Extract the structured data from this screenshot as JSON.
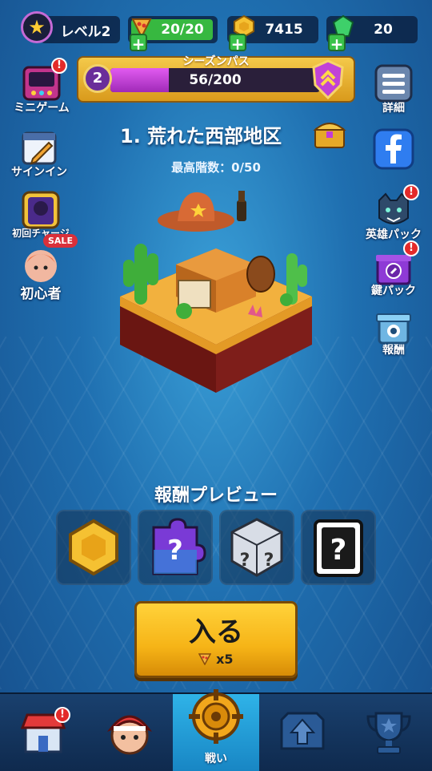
{
  "top_bar": {
    "level_label": "レベル2",
    "energy": "20/20",
    "coins": "7415",
    "gems": "20"
  },
  "season_pass": {
    "title": "シーズンパス",
    "level": "2",
    "progress_text": "56/200",
    "progress_fraction": 0.28
  },
  "left_menu": {
    "minigame": "ミニゲーム",
    "signin": "サインイン",
    "first_charge": "初回チャージ",
    "beginner": "初心者",
    "sale_tag": "SALE"
  },
  "right_menu": {
    "details": "詳細",
    "hero_pack": "英雄パック",
    "key_pack": "鍵パック",
    "reward": "報酬"
  },
  "stage": {
    "title": "1. 荒れた西部地区",
    "max_floor": "最高階数：0/50"
  },
  "rewards": {
    "title": "報酬プレビュー",
    "items": [
      "gold-coin-icon",
      "mystery-puzzle-icon",
      "mystery-dice-icon",
      "mystery-card-icon"
    ]
  },
  "enter_button": {
    "label": "入る",
    "cost": "x5"
  },
  "bottom_nav": {
    "items": [
      {
        "icon": "shop-icon",
        "label": ""
      },
      {
        "icon": "hero-icon",
        "label": ""
      },
      {
        "icon": "battle-icon",
        "label": "戦い"
      },
      {
        "icon": "upgrade-icon",
        "label": ""
      },
      {
        "icon": "trophy-icon",
        "label": ""
      }
    ]
  },
  "colors": {
    "accent_gold": "#f6b417",
    "pass_purple": "#c03ad6",
    "energy_green": "#3ac24a",
    "alert_red": "#e32a2a"
  }
}
